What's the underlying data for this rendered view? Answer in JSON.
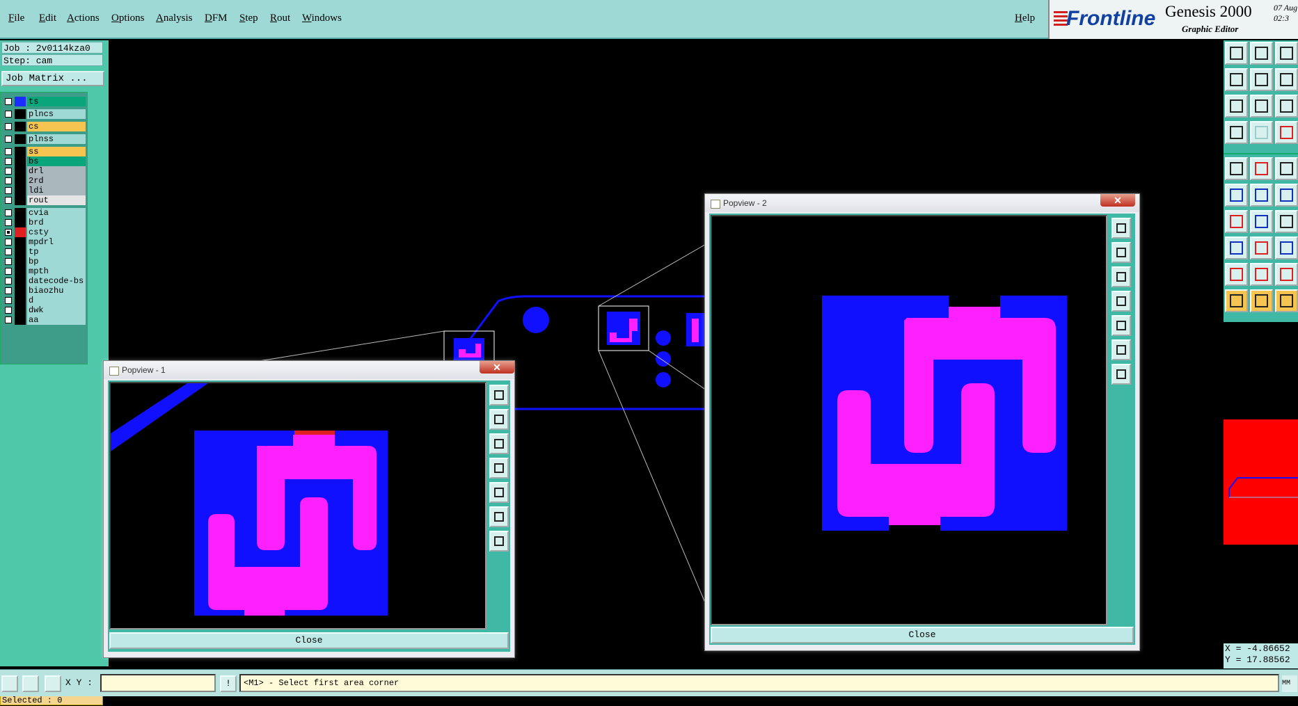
{
  "menu": {
    "items": [
      "File",
      "Edit",
      "Actions",
      "Options",
      "Analysis",
      "DFM",
      "Step",
      "Rout",
      "Windows"
    ],
    "help": "Help"
  },
  "brand": {
    "logo": "Frontline",
    "product": "Genesis 2000",
    "subtitle": "Graphic Editor",
    "date_line1": "07 Aug",
    "date_line2": "02:3"
  },
  "job": {
    "job_label": "Job : 2v0114kza0",
    "step_label": "Step: cam",
    "matrix_button": "Job Matrix ..."
  },
  "layers": [
    {
      "name": "ts",
      "color": "#0aa57a",
      "swatch": "#1a2cff",
      "checked": false
    },
    {
      "name": "plncs",
      "color": "#9fd9d6",
      "swatch": "#000",
      "checked": false
    },
    {
      "name": "cs",
      "color": "#f6c451",
      "swatch": "#000",
      "checked": false
    },
    {
      "name": "plnss",
      "color": "#9fd9d6",
      "swatch": "#000",
      "checked": false
    },
    {
      "name": "ss",
      "color": "#f6c451",
      "swatch": "#000",
      "checked": false
    },
    {
      "name": "bs",
      "color": "#0aa57a",
      "swatch": "#000",
      "checked": false
    },
    {
      "name": "drl",
      "color": "#aab7bd",
      "swatch": "#000",
      "checked": false
    },
    {
      "name": "2rd",
      "color": "#aab7bd",
      "swatch": "#000",
      "checked": false
    },
    {
      "name": "ldi",
      "color": "#aab7bd",
      "swatch": "#000",
      "checked": false
    },
    {
      "name": "rout",
      "color": "#e5e5e5",
      "swatch": "#000",
      "checked": false
    },
    {
      "name": "cvia",
      "color": "#9fd9d6",
      "swatch": "#000",
      "checked": false
    },
    {
      "name": "brd",
      "color": "#9fd9d6",
      "swatch": "#000",
      "checked": false
    },
    {
      "name": "csty",
      "color": "#9fd9d6",
      "swatch": "#e02020",
      "checked": true
    },
    {
      "name": "mpdrl",
      "color": "#9fd9d6",
      "swatch": "#000",
      "checked": false
    },
    {
      "name": "tp",
      "color": "#9fd9d6",
      "swatch": "#000",
      "checked": false
    },
    {
      "name": "bp",
      "color": "#9fd9d6",
      "swatch": "#000",
      "checked": false
    },
    {
      "name": "mpth",
      "color": "#9fd9d6",
      "swatch": "#000",
      "checked": false
    },
    {
      "name": "datecode-bs",
      "color": "#9fd9d6",
      "swatch": "#000",
      "checked": false
    },
    {
      "name": "biaozhu",
      "color": "#9fd9d6",
      "swatch": "#000",
      "checked": false
    },
    {
      "name": "d",
      "color": "#9fd9d6",
      "swatch": "#000",
      "checked": false
    },
    {
      "name": "dwk",
      "color": "#9fd9d6",
      "swatch": "#000",
      "checked": false
    },
    {
      "name": "aa",
      "color": "#9fd9d6",
      "swatch": "#000",
      "checked": false
    }
  ],
  "selected_label": "Selected : 0",
  "coords": {
    "x": "X = -4.86652",
    "y": "Y = 17.88562"
  },
  "status": {
    "xy_label": "X Y :",
    "xy_value": "",
    "bang": "!",
    "prompt": "<M1> - Select first area corner",
    "mm": "MM"
  },
  "popview1": {
    "title": "Popview - 1",
    "close": "Close",
    "x": "✕"
  },
  "popview2": {
    "title": "Popview - 2",
    "close": "Close",
    "x": "✕"
  },
  "colors": {
    "pad_blue": "#1010ff",
    "pad_magenta": "#ff20ff",
    "line_red": "#e02020"
  }
}
